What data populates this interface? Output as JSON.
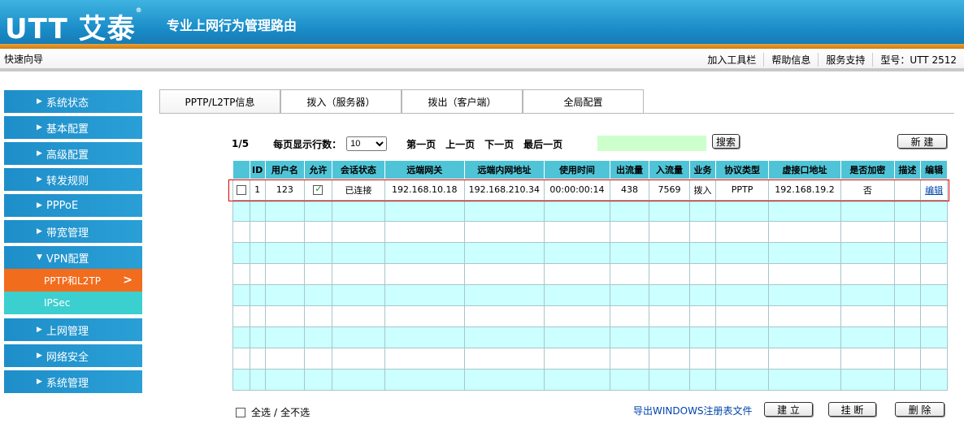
{
  "header": {
    "logo": "UTT 艾泰",
    "logo_mark": "®",
    "slogan": "专业上网行为管理路由"
  },
  "subbar": {
    "quick_guide": "快速向导",
    "links": [
      "加入工具栏",
      "帮助信息",
      "服务支持",
      "型号：UTT 2512"
    ]
  },
  "sidebar": {
    "items": [
      {
        "label": "系统状态"
      },
      {
        "label": "基本配置"
      },
      {
        "label": "高级配置"
      },
      {
        "label": "转发规则"
      },
      {
        "label": "PPPoE"
      },
      {
        "label": "带宽管理"
      },
      {
        "label": "VPN配置"
      }
    ],
    "vpn_sub": [
      {
        "label": "PPTP和L2TP",
        "active": true
      },
      {
        "label": "IPSec",
        "active": false
      }
    ],
    "items_after": [
      {
        "label": "上网管理"
      },
      {
        "label": "网络安全"
      },
      {
        "label": "系统管理"
      }
    ],
    "active_color": "#f26c1d",
    "item_color": "#1e8ec9"
  },
  "tabs": [
    "PPTP/L2TP信息",
    "拨入（服务器）",
    "拨出（客户端）",
    "全局配置"
  ],
  "pager": {
    "page": "1/5",
    "rows_label": "每页显示行数：",
    "rows_value": "10",
    "first": "第一页",
    "prev": "上一页",
    "next": "下一页",
    "last": "最后一页",
    "search_btn": "搜索",
    "new_btn": "新 建"
  },
  "table": {
    "headers": [
      "",
      "ID",
      "用户名",
      "允许",
      "会话状态",
      "远端网关",
      "远端内网地址",
      "使用时间",
      "出流量",
      "入流量",
      "业务",
      "协议类型",
      "虚接口地址",
      "是否加密",
      "描述",
      "编辑"
    ],
    "rows": [
      {
        "id": "1",
        "user": "123",
        "allow": true,
        "status": "已连接",
        "gateway": "192.168.10.18",
        "lan": "192.168.210.34",
        "time": "00:00:00:14",
        "out": "438",
        "in": "7569",
        "service": "拨入",
        "protocol": "PPTP",
        "vif": "192.168.19.2",
        "encrypt": "否",
        "desc": "",
        "edit": "编辑"
      }
    ],
    "empty_rows": 9,
    "header_color": "#50c4d7",
    "stripe_color": "#ccffff"
  },
  "footer": {
    "select_all": "全选",
    "separator": "/",
    "deselect": "全不选",
    "export": "导出WINDOWS注册表文件",
    "connect": "建 立",
    "hangup": "挂 断",
    "delete": "删 除"
  }
}
